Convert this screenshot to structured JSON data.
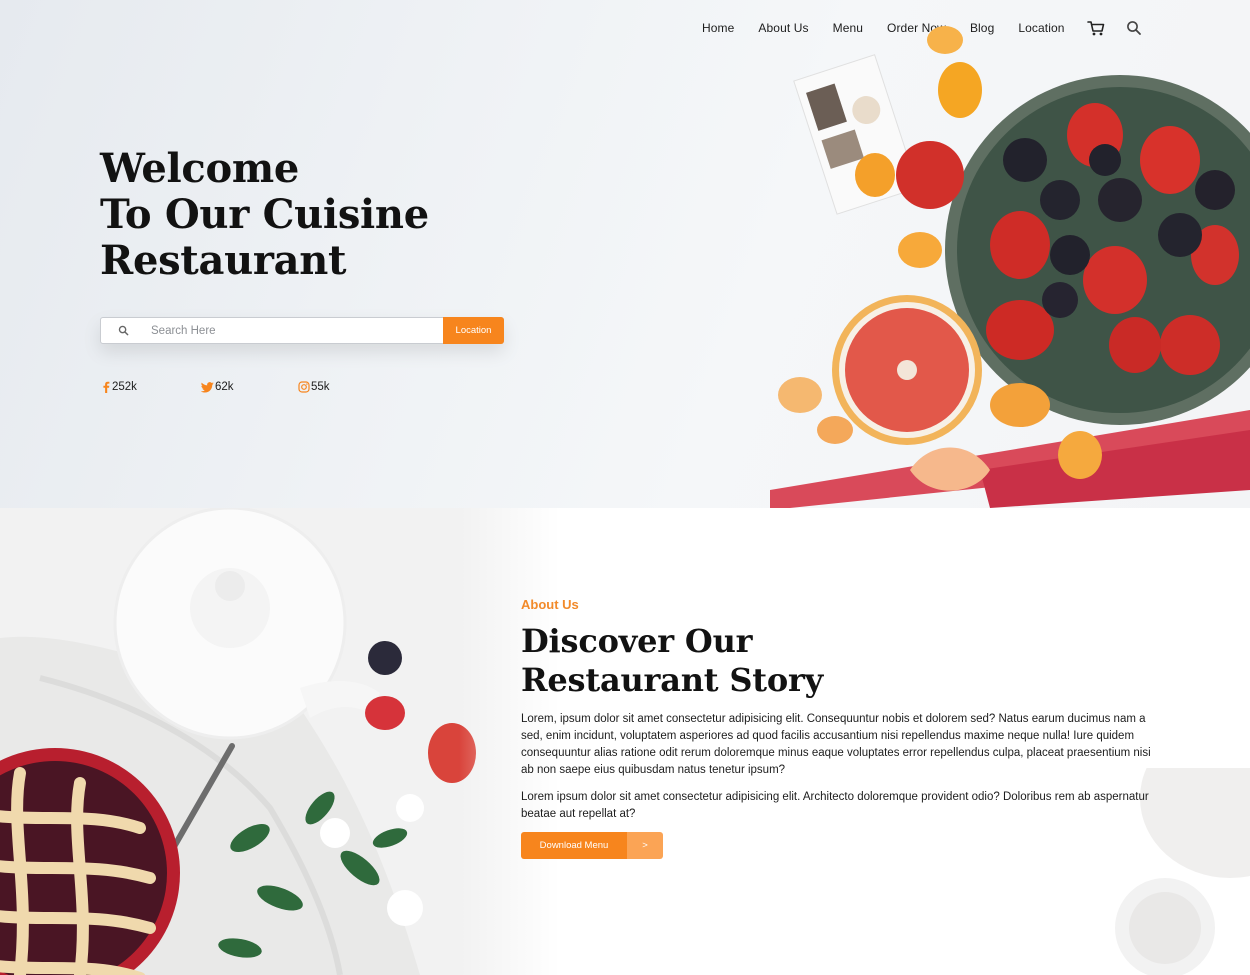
{
  "nav": {
    "items": [
      "Home",
      "About Us",
      "Menu",
      "Order Now",
      "Blog",
      "Location"
    ],
    "cart_icon": "cart-icon",
    "search_icon": "search-icon"
  },
  "hero": {
    "title_lines": [
      "Welcome",
      "To Our Cuisine",
      "Restaurant"
    ],
    "search": {
      "placeholder": "Search Here",
      "value": "",
      "button_label": "Location"
    },
    "socials": [
      {
        "icon": "facebook-icon",
        "count": "252k"
      },
      {
        "icon": "twitter-icon",
        "count": "62k"
      },
      {
        "icon": "instagram-icon",
        "count": "55k"
      }
    ]
  },
  "about": {
    "eyebrow": "About Us",
    "title_lines": [
      "Discover Our",
      "Restaurant Story"
    ],
    "paragraphs": [
      "Lorem, ipsum dolor sit amet consectetur adipisicing elit. Consequuntur nobis et dolorem sed? Natus earum ducimus nam a sed, enim incidunt, voluptatem asperiores ad quod facilis accusantium nisi repellendus maxime neque nulla! Iure quidem consequuntur alias ratione odit rerum doloremque minus eaque voluptates error repellendus culpa, placeat praesentium nisi ab non saepe eius quibusdam natus tenetur ipsum?",
      "Lorem ipsum dolor sit amet consectetur adipisicing elit. Architecto doloremque provident odio? Doloribus rem ab aspernatur beatae aut repellat at?"
    ],
    "download_label": "Download Menu",
    "download_arrow": ">"
  },
  "colors": {
    "accent": "#f7851d",
    "accent_light": "#fba455",
    "eyebrow": "#f28a2a",
    "text": "#121212"
  }
}
